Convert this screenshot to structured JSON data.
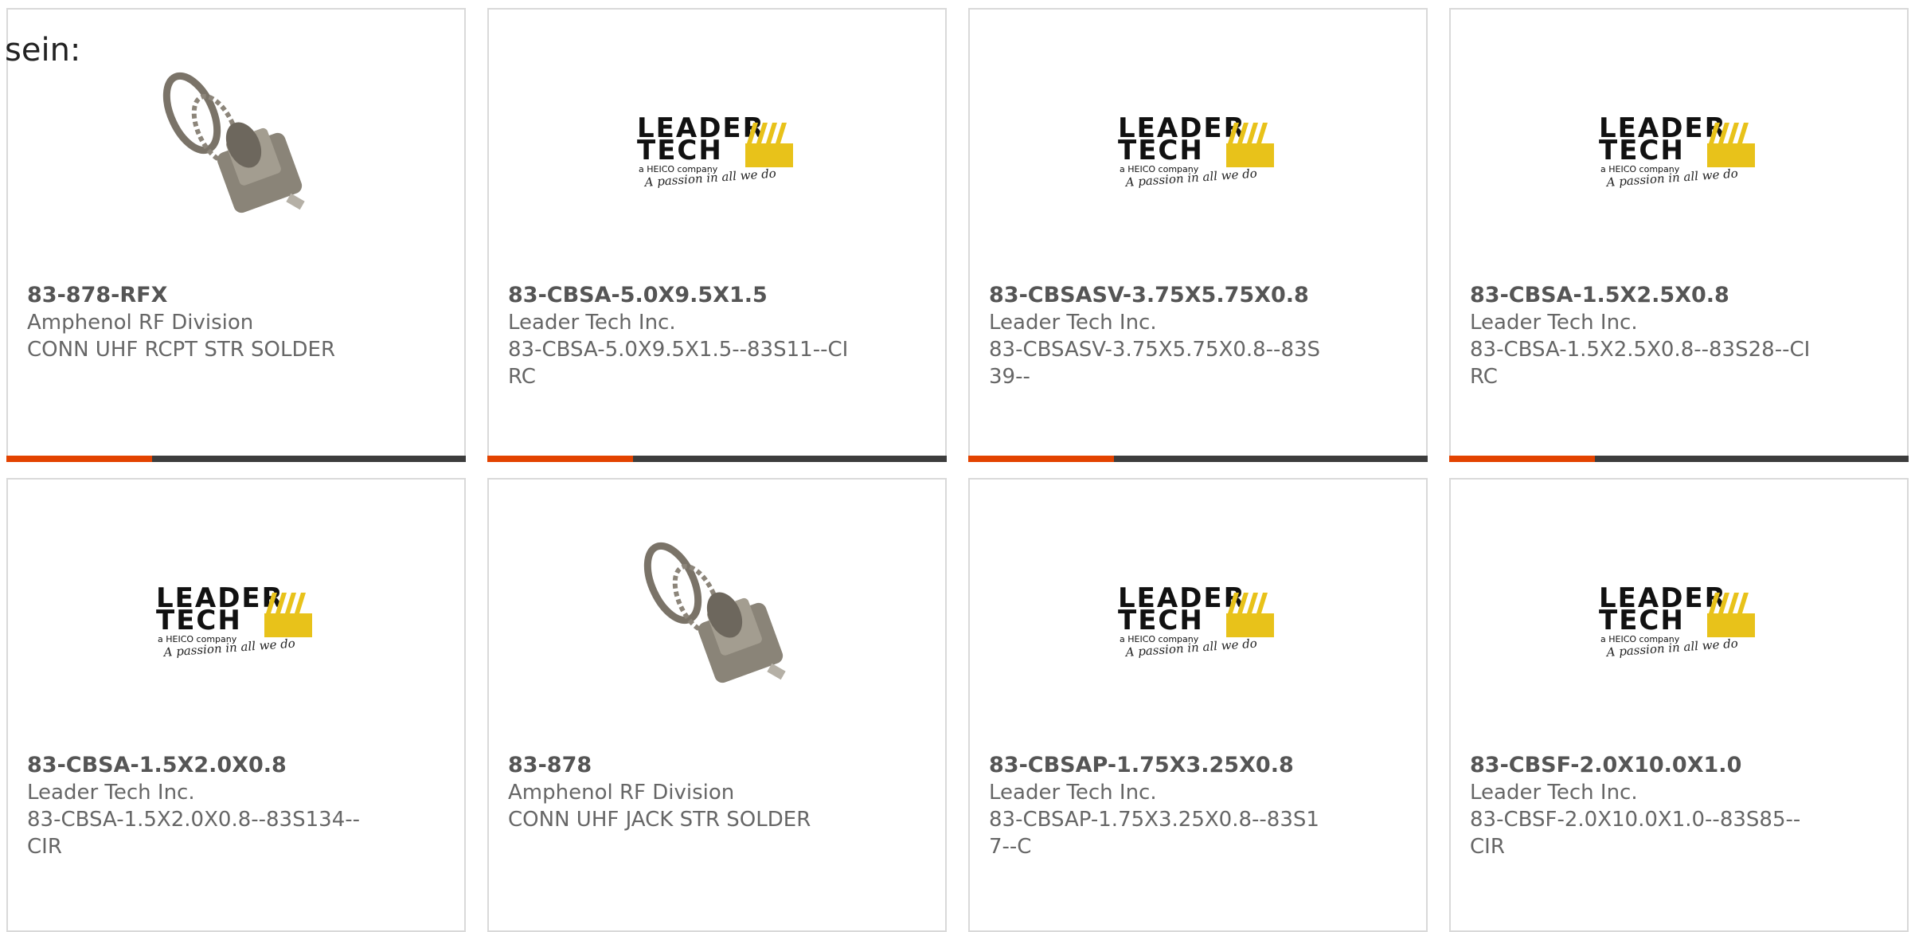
{
  "intro_text": "sein:",
  "logo": {
    "line1": "LEADER",
    "line2": "TECH",
    "line3": "a HEICO company",
    "line4": "A passion in all we do"
  },
  "colors": {
    "accent": "#e34300",
    "bar_dark": "#3d3d3d",
    "logo_yellow": "#e8c21a"
  },
  "products": [
    {
      "part": "83-878-RFX",
      "manufacturer": "Amphenol RF Division",
      "description": "CONN UHF RCPT STR SOLDER",
      "image": "connector-photo"
    },
    {
      "part": "83-CBSA-5.0X9.5X1.5",
      "manufacturer": "Leader Tech Inc.",
      "description": "83-CBSA-5.0X9.5X1.5--83S11--CIRC",
      "image": "leader-tech-logo"
    },
    {
      "part": "83-CBSASV-3.75X5.75X0.8",
      "manufacturer": "Leader Tech Inc.",
      "description": "83-CBSASV-3.75X5.75X0.8--83S39--",
      "image": "leader-tech-logo"
    },
    {
      "part": "83-CBSA-1.5X2.5X0.8",
      "manufacturer": "Leader Tech Inc.",
      "description": "83-CBSA-1.5X2.5X0.8--83S28--CIRC",
      "image": "leader-tech-logo"
    },
    {
      "part": "83-CBSA-1.5X2.0X0.8",
      "manufacturer": "Leader Tech Inc.",
      "description": "83-CBSA-1.5X2.0X0.8--83S134--CIR",
      "image": "leader-tech-logo"
    },
    {
      "part": "83-878",
      "manufacturer": "Amphenol RF Division",
      "description": "CONN UHF JACK STR SOLDER",
      "image": "connector-photo"
    },
    {
      "part": "83-CBSAP-1.75X3.25X0.8",
      "manufacturer": "Leader Tech Inc.",
      "description": "83-CBSAP-1.75X3.25X0.8--83S17--C",
      "image": "leader-tech-logo"
    },
    {
      "part": "83-CBSF-2.0X10.0X1.0",
      "manufacturer": "Leader Tech Inc.",
      "description": "83-CBSF-2.0X10.0X1.0--83S85--CIR",
      "image": "leader-tech-logo"
    }
  ]
}
